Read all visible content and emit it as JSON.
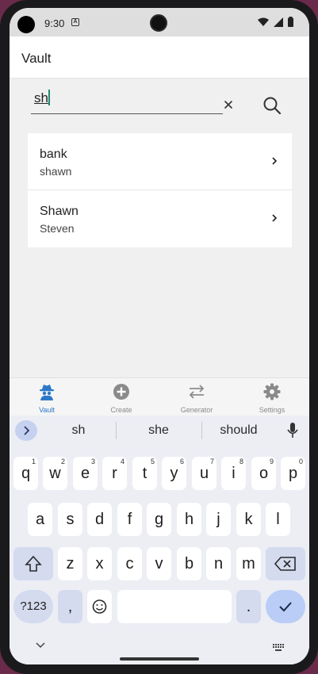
{
  "status": {
    "time": "9:30"
  },
  "appbar": {
    "title": "Vault"
  },
  "search": {
    "value": "sh",
    "placeholder": ""
  },
  "results": [
    {
      "title": "bank",
      "subtitle": "shawn"
    },
    {
      "title": "Shawn",
      "subtitle": "Steven"
    }
  ],
  "nav": [
    {
      "label": "Vault",
      "icon": "spy-icon",
      "active": true
    },
    {
      "label": "Create",
      "icon": "add-circle-icon",
      "active": false
    },
    {
      "label": "Generator",
      "icon": "swap-arrows-icon",
      "active": false
    },
    {
      "label": "Settings",
      "icon": "gear-icon",
      "active": false
    }
  ],
  "keyboard": {
    "suggestions": [
      "sh",
      "she",
      "should"
    ],
    "row1": [
      "q",
      "w",
      "e",
      "r",
      "t",
      "y",
      "u",
      "i",
      "o",
      "p"
    ],
    "row1_numbers": [
      "1",
      "2",
      "3",
      "4",
      "5",
      "6",
      "7",
      "8",
      "9",
      "0"
    ],
    "row2": [
      "a",
      "s",
      "d",
      "f",
      "g",
      "h",
      "j",
      "k",
      "l"
    ],
    "row3": [
      "z",
      "x",
      "c",
      "v",
      "b",
      "n",
      "m"
    ],
    "symbols_label": "?123",
    "comma": ",",
    "period": "."
  },
  "colors": {
    "accent": "#2b78c8",
    "keyboard_action": "#b9cdf6"
  }
}
